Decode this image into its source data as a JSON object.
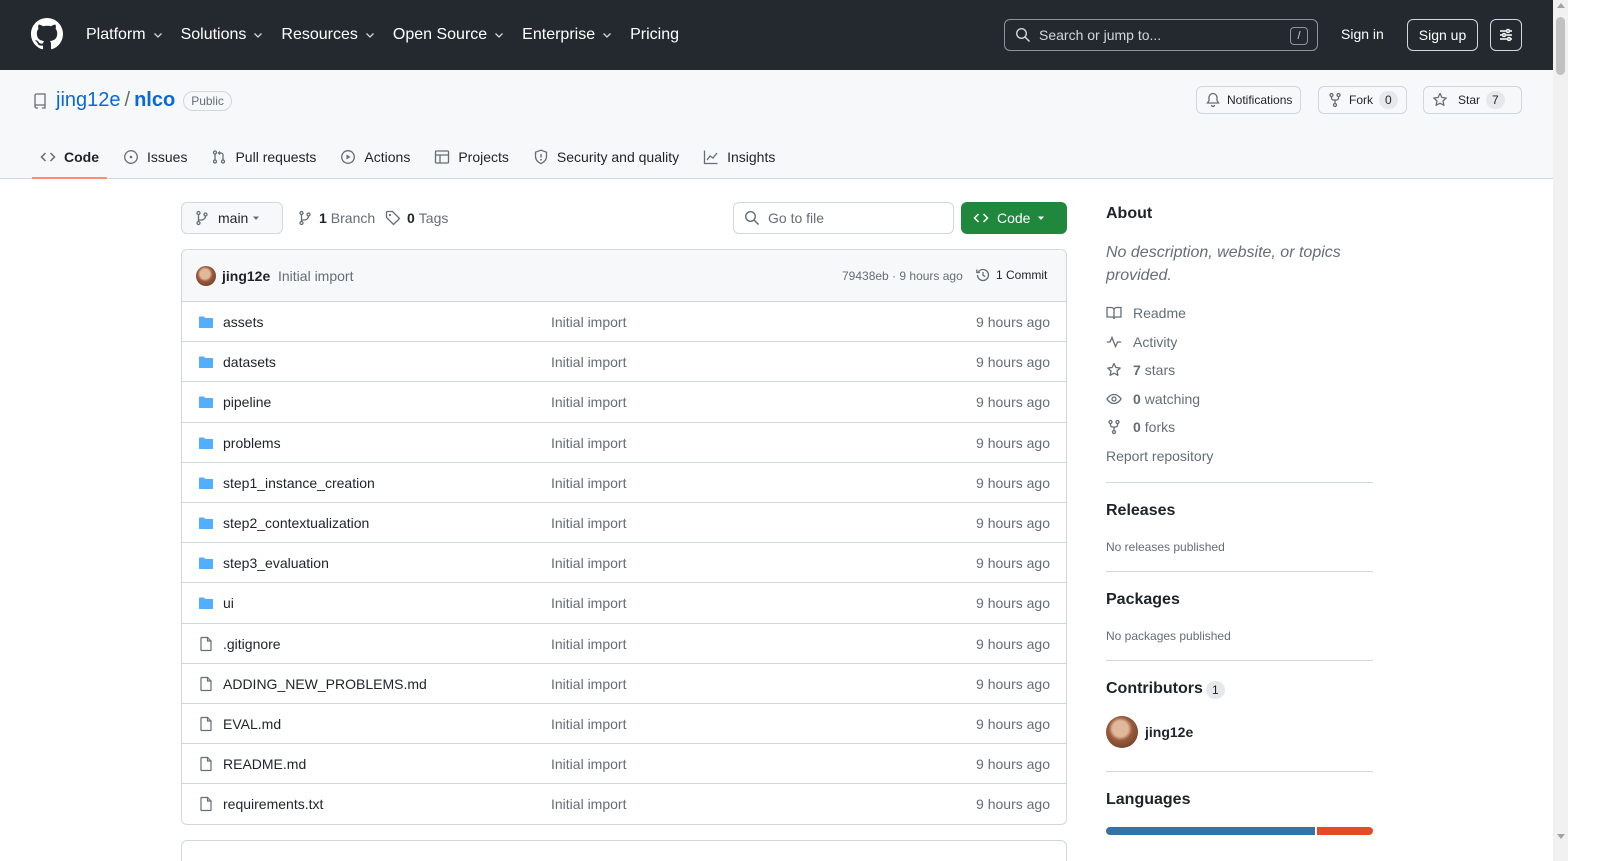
{
  "header": {
    "nav": [
      {
        "label": "Platform",
        "has_dropdown": true
      },
      {
        "label": "Solutions",
        "has_dropdown": true
      },
      {
        "label": "Resources",
        "has_dropdown": true
      },
      {
        "label": "Open Source",
        "has_dropdown": true
      },
      {
        "label": "Enterprise",
        "has_dropdown": true
      },
      {
        "label": "Pricing",
        "has_dropdown": false
      }
    ],
    "search_placeholder": "Search or jump to...",
    "search_shortcut": "/",
    "sign_in": "Sign in",
    "sign_up": "Sign up"
  },
  "repo": {
    "owner": "jing12e",
    "separator": "/",
    "name": "nlco",
    "visibility": "Public",
    "notifications_label": "Notifications",
    "fork_label": "Fork",
    "fork_count": "0",
    "star_label": "Star",
    "star_count": "7"
  },
  "tabs": [
    {
      "label": "Code",
      "icon": "code-icon",
      "active": true
    },
    {
      "label": "Issues",
      "icon": "issue-icon",
      "active": false
    },
    {
      "label": "Pull requests",
      "icon": "pull-request-icon",
      "active": false
    },
    {
      "label": "Actions",
      "icon": "play-icon",
      "active": false
    },
    {
      "label": "Projects",
      "icon": "table-icon",
      "active": false
    },
    {
      "label": "Security and quality",
      "icon": "shield-icon",
      "active": false
    },
    {
      "label": "Insights",
      "icon": "graph-icon",
      "active": false
    }
  ],
  "toolbar": {
    "branch": "main",
    "branch_count": "1",
    "branch_label": "Branch",
    "tag_count": "0",
    "tag_label": "Tags",
    "goto_placeholder": "Go to file",
    "code_button": "Code"
  },
  "commit": {
    "author": "jing12e",
    "message": "Initial import",
    "hash_time": "79438eb · 9 hours ago",
    "commits": "1 Commit"
  },
  "files": [
    {
      "name": "assets",
      "type": "folder",
      "message": "Initial import",
      "date": "9 hours ago"
    },
    {
      "name": "datasets",
      "type": "folder",
      "message": "Initial import",
      "date": "9 hours ago"
    },
    {
      "name": "pipeline",
      "type": "folder",
      "message": "Initial import",
      "date": "9 hours ago"
    },
    {
      "name": "problems",
      "type": "folder",
      "message": "Initial import",
      "date": "9 hours ago"
    },
    {
      "name": "step1_instance_creation",
      "type": "folder",
      "message": "Initial import",
      "date": "9 hours ago"
    },
    {
      "name": "step2_contextualization",
      "type": "folder",
      "message": "Initial import",
      "date": "9 hours ago"
    },
    {
      "name": "step3_evaluation",
      "type": "folder",
      "message": "Initial import",
      "date": "9 hours ago"
    },
    {
      "name": "ui",
      "type": "folder",
      "message": "Initial import",
      "date": "9 hours ago"
    },
    {
      "name": ".gitignore",
      "type": "file",
      "message": "Initial import",
      "date": "9 hours ago"
    },
    {
      "name": "ADDING_NEW_PROBLEMS.md",
      "type": "file",
      "message": "Initial import",
      "date": "9 hours ago"
    },
    {
      "name": "EVAL.md",
      "type": "file",
      "message": "Initial import",
      "date": "9 hours ago"
    },
    {
      "name": "README.md",
      "type": "file",
      "message": "Initial import",
      "date": "9 hours ago"
    },
    {
      "name": "requirements.txt",
      "type": "file",
      "message": "Initial import",
      "date": "9 hours ago"
    }
  ],
  "sidebar": {
    "about_title": "About",
    "about_desc": "No description, website, or topics provided.",
    "readme": "Readme",
    "activity": "Activity",
    "stars_count": "7",
    "stars_label": "stars",
    "watching_count": "0",
    "watching_label": "watching",
    "forks_count": "0",
    "forks_label": "forks",
    "report": "Report repository",
    "releases_title": "Releases",
    "releases_text": "No releases published",
    "packages_title": "Packages",
    "packages_text": "No packages published",
    "contributors_title": "Contributors",
    "contributors_count": "1",
    "contributor_name": "jing12e",
    "languages_title": "Languages",
    "language_colors": [
      "#3572A5",
      "#e34c26"
    ]
  },
  "colors": {
    "header_bg": "#24292f",
    "link": "#0969da",
    "primary_button": "#1f883d",
    "active_tab_underline": "#fd8c73",
    "folder": "#54aeff"
  }
}
